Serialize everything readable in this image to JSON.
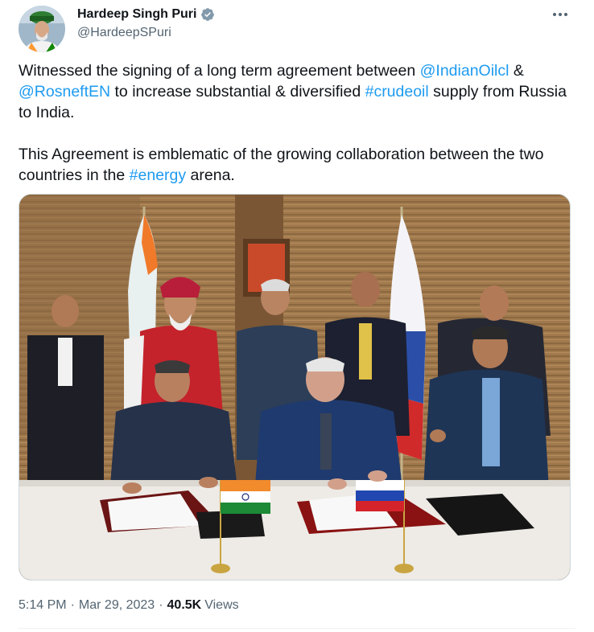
{
  "author": {
    "name": "Hardeep Singh Puri",
    "handle": "@HardeepSPuri",
    "verified_color": "#829aab"
  },
  "tweet": {
    "p1_pre": "Witnessed the signing of a long term agreement between ",
    "mention1": "@IndianOilcl",
    "p1_amp": " &",
    "mention2": "@RosneftEN",
    "p1_mid": " to increase substantial & diversified ",
    "hashtag1": "#crudeoil",
    "p1_post": " supply from Russia to India.",
    "p2_pre": "This Agreement is emblematic of the growing collaboration between the two countries in the ",
    "hashtag2": "#energy",
    "p2_post": " arena."
  },
  "meta": {
    "time": "5:14 PM",
    "date": "Mar 29, 2023",
    "views_count": "40.5K",
    "views_label": "Views"
  },
  "colors": {
    "link": "#1d9bf0",
    "text": "#0f1419",
    "secondary": "#536471"
  },
  "icons": [
    "verified-badge-icon",
    "more-options-icon"
  ]
}
